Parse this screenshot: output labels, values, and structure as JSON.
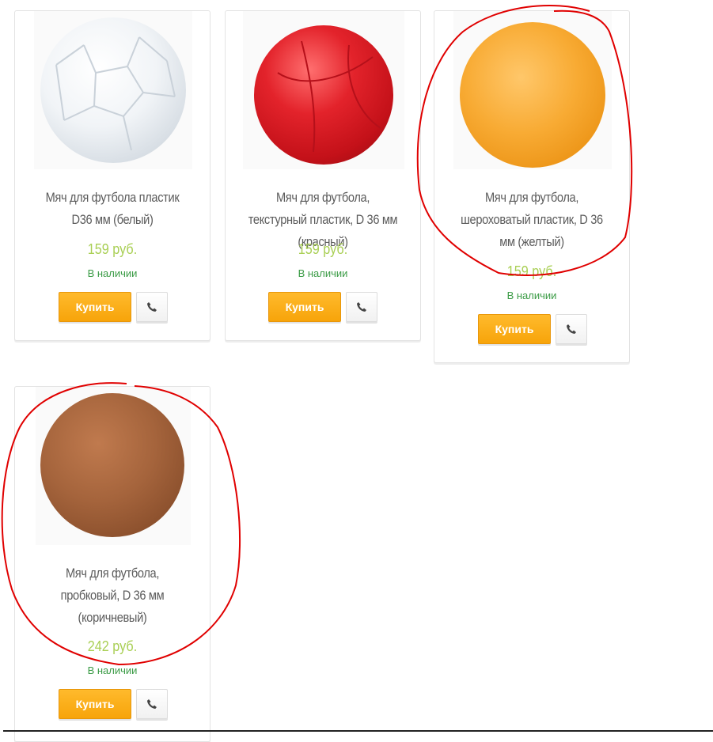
{
  "products": [
    {
      "title": "Мяч для футбола пластик D36 мм (белый)",
      "price": "159 руб.",
      "availability": "В наличии",
      "buy_label": "Купить",
      "call_icon": "phone-icon",
      "ball_color": "#eef1f4"
    },
    {
      "title": "Мяч для футбола, текстурный пластик, D 36 мм (красный)",
      "price": "159 руб.",
      "availability": "В наличии",
      "buy_label": "Купить",
      "call_icon": "phone-icon",
      "ball_color": "#e01e26"
    },
    {
      "title": "Мяч для футбола, шероховатый пластик, D 36 мм (желтый)",
      "price": "159 руб.",
      "availability": "В наличии",
      "buy_label": "Купить",
      "call_icon": "phone-icon",
      "ball_color": "#f7a92b"
    },
    {
      "title": "Мяч для футбола, пробковый, D 36 мм (коричневый)",
      "price": "242 руб.",
      "availability": "В наличии",
      "buy_label": "Купить",
      "call_icon": "phone-icon",
      "ball_color": "#a0603a"
    }
  ],
  "colors": {
    "price": "#a9cf54",
    "availability": "#3a9b45",
    "buy_button": "#f7a40a",
    "annotation": "#e00000"
  }
}
